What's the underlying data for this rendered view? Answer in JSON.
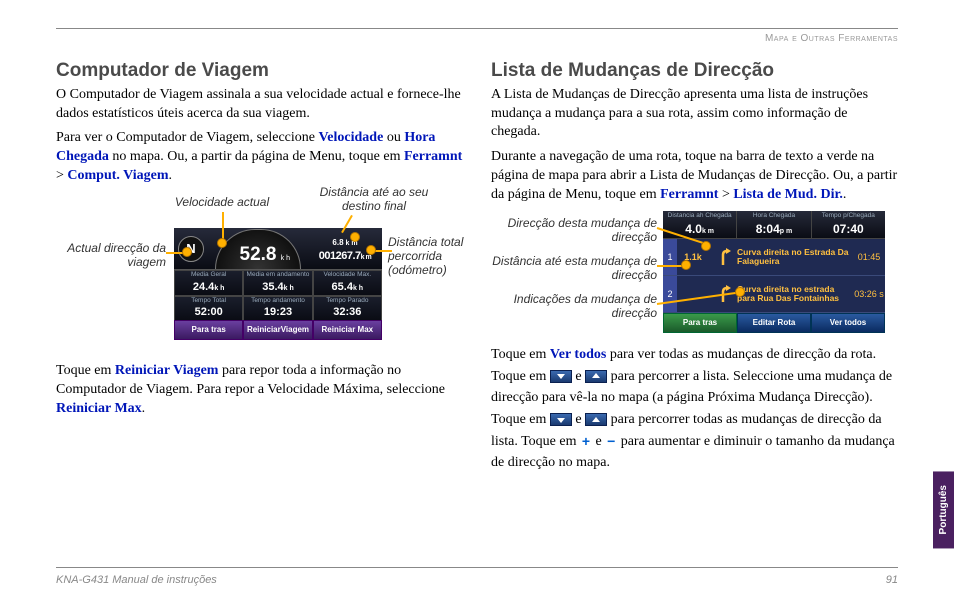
{
  "header": {
    "section": "Mapa e Outras Ferramentas"
  },
  "left": {
    "title": "Computador de Viagem",
    "p1": "O Computador de Viagem assinala a sua velocidade actual e fornece-lhe dados estatísticos úteis acerca da sua viagem.",
    "p2a": "Para ver o Computador de Viagem, seleccione ",
    "p2_link1": "Velocidade",
    "p2b": " ou ",
    "p2_link2": "Hora Chegada",
    "p2c": " no mapa. Ou, a partir da página de Menu, toque em ",
    "p2_link3": "Ferramnt",
    "p2_gt": " > ",
    "p2_link4": "Comput. Viagem",
    "p2d": ".",
    "callouts": {
      "speed": "Velocidade actual",
      "dest": "Distância até ao seu destino final",
      "dir": "Actual direcção da viagem",
      "odo": "Distância total percorrida (odómetro)"
    },
    "device": {
      "compass": "N",
      "speed": "52.8",
      "speed_unit": "k h",
      "odo_km": "6.8",
      "odo_big": "001267.7",
      "cells": [
        {
          "lbl": "Media Geral",
          "val": "24.4",
          "u": "k h"
        },
        {
          "lbl": "Media em andamento",
          "val": "35.4",
          "u": "k h"
        },
        {
          "lbl": "Velocidade Max.",
          "val": "65.4",
          "u": "k h"
        },
        {
          "lbl": "Tempo Total",
          "val": "52:00",
          "u": ""
        },
        {
          "lbl": "Tempo andamento",
          "val": "19:23",
          "u": ""
        },
        {
          "lbl": "Tempo Parado",
          "val": "32:36",
          "u": ""
        }
      ],
      "btns": [
        "Para tras",
        "ReiniciarViagem",
        "Reiniciar Max"
      ]
    },
    "p3a": "Toque em ",
    "p3_link1": "Reiniciar Viagem",
    "p3b": " para repor toda a informação no Computador de Viagem. Para repor a Velocidade Máxima, seleccione ",
    "p3_link2": "Reiniciar Max",
    "p3c": "."
  },
  "right": {
    "title": "Lista de Mudanças de Direcção",
    "p1": "A Lista de Mudanças de Direcção apresenta uma lista de instruções mudança a mudança para a sua rota, assim como informação de chegada.",
    "p2a": "Durante a navegação de uma rota, toque na barra de texto a verde na página de mapa para abrir a Lista de Mudanças de Direcção. Ou, a partir da página de Menu, toque em ",
    "p2_link1": "Ferramnt",
    "p2_gt": " > ",
    "p2_link2": "Lista de Mud. Dir.",
    "p2b": ".",
    "callouts": {
      "dir": "Direcção desta mudança de direcção",
      "dist": "Distância até esta mudança de direcção",
      "instr": "Indicações da mudança de direcção"
    },
    "device": {
      "hdr": [
        {
          "lbl": "Distancia ah Chegada",
          "val": "4.0",
          "u": "k m"
        },
        {
          "lbl": "Hora Chegada",
          "val": "8:04",
          "u": "p m"
        },
        {
          "lbl": "Tempo p/Chegada",
          "val": "07:40",
          "u": ""
        }
      ],
      "rows": [
        {
          "n": "1",
          "d": "1.1k",
          "t": "Curva direita no Estrada Da Falagueira",
          "time": "01:45"
        },
        {
          "n": "2",
          "d": "",
          "t": "Curva direita no estrada para Rua Das Fontainhas",
          "time": "03:26 s"
        }
      ],
      "btns": [
        "Para tras",
        "Editar Rota",
        "Ver todos"
      ]
    },
    "p3a": "Toque em ",
    "p3_link1": "Ver todos",
    "p3b": " para ver todas as mudanças de direcção da rota. Toque em ",
    "p3c": " e ",
    "p3d": " para percorrer a lista. Seleccione uma mudança de direcção para vê-la no mapa (a página Próxima Mudança Direcção). Toque em ",
    "p3e": " e ",
    "p3f": " para percorrer todas as mudanças de direcção da lista. Toque em ",
    "p3g": " e ",
    "p3h": " para aumentar e diminuir o tamanho da mudança de direcção no mapa."
  },
  "footer": {
    "manual": "KNA-G431 Manual de instruções",
    "page": "91"
  },
  "lang_tab": "Português"
}
